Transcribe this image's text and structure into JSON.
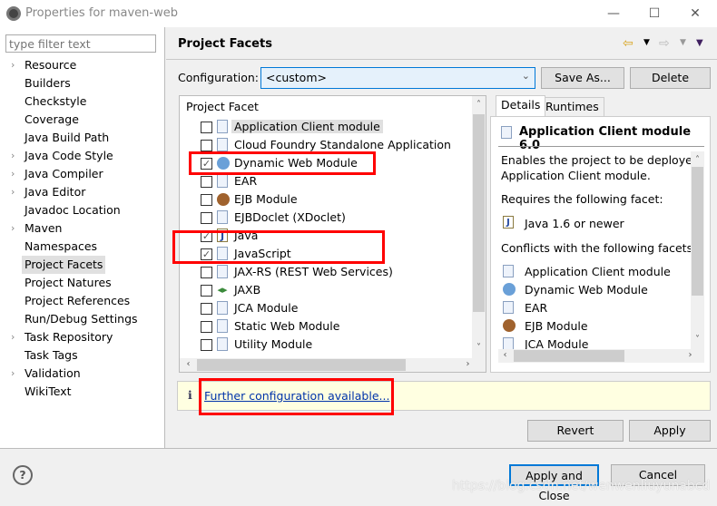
{
  "window": {
    "title": "Properties for maven-web",
    "minimize": "—",
    "maximize": "☐",
    "close": "✕"
  },
  "sidebar": {
    "filter_placeholder": "type filter text",
    "items": [
      {
        "label": "Resource",
        "expandable": true
      },
      {
        "label": "Builders",
        "expandable": false
      },
      {
        "label": "Checkstyle",
        "expandable": false
      },
      {
        "label": "Coverage",
        "expandable": false
      },
      {
        "label": "Java Build Path",
        "expandable": false
      },
      {
        "label": "Java Code Style",
        "expandable": true
      },
      {
        "label": "Java Compiler",
        "expandable": true
      },
      {
        "label": "Java Editor",
        "expandable": true
      },
      {
        "label": "Javadoc Location",
        "expandable": false
      },
      {
        "label": "Maven",
        "expandable": true
      },
      {
        "label": "Namespaces",
        "expandable": false
      },
      {
        "label": "Project Facets",
        "expandable": false,
        "selected": true
      },
      {
        "label": "Project Natures",
        "expandable": false
      },
      {
        "label": "Project References",
        "expandable": false
      },
      {
        "label": "Run/Debug Settings",
        "expandable": false
      },
      {
        "label": "Task Repository",
        "expandable": true
      },
      {
        "label": "Task Tags",
        "expandable": false
      },
      {
        "label": "Validation",
        "expandable": true
      },
      {
        "label": "WikiText",
        "expandable": false
      }
    ]
  },
  "header": {
    "title": "Project Facets",
    "back": "⇦",
    "forward": "⇨",
    "menu": "▼"
  },
  "configuration": {
    "label": "Configuration:",
    "value": "<custom>",
    "save_as": "Save As...",
    "delete": "Delete"
  },
  "facets": {
    "header": "Project Facet",
    "items": [
      {
        "label": "Application Client module",
        "checked": false,
        "icon": "doc"
      },
      {
        "label": "Cloud Foundry Standalone Application",
        "checked": false,
        "icon": "doc"
      },
      {
        "label": "Dynamic Web Module",
        "checked": true,
        "icon": "globe"
      },
      {
        "label": "EAR",
        "checked": false,
        "icon": "doc"
      },
      {
        "label": "EJB Module",
        "checked": false,
        "icon": "bean"
      },
      {
        "label": "EJBDoclet (XDoclet)",
        "checked": false,
        "icon": "doc"
      },
      {
        "label": "Java",
        "checked": true,
        "icon": "java"
      },
      {
        "label": "JavaScript",
        "checked": true,
        "icon": "doc"
      },
      {
        "label": "JAX-RS (REST Web Services)",
        "checked": false,
        "icon": "doc"
      },
      {
        "label": "JAXB",
        "checked": false,
        "icon": "jaxb"
      },
      {
        "label": "JCA Module",
        "checked": false,
        "icon": "doc"
      },
      {
        "label": "Static Web Module",
        "checked": false,
        "icon": "doc"
      },
      {
        "label": "Utility Module",
        "checked": false,
        "icon": "doc"
      }
    ]
  },
  "details": {
    "tabs": [
      "Details",
      "Runtimes"
    ],
    "title": "Application Client module 6.0",
    "description_1": "Enables the project to be deployed",
    "description_2": "Application Client module.",
    "requires_label": "Requires the following facet:",
    "requires": [
      "Java 1.6 or newer"
    ],
    "conflicts_label": "Conflicts with the following facets:",
    "conflicts": [
      {
        "label": "Application Client module",
        "icon": "doc"
      },
      {
        "label": "Dynamic Web Module",
        "icon": "globe"
      },
      {
        "label": "EAR",
        "icon": "doc"
      },
      {
        "label": "EJB Module",
        "icon": "bean"
      },
      {
        "label": "JCA Module",
        "icon": "doc"
      }
    ]
  },
  "info": {
    "icon": "i",
    "link": "Further configuration available..."
  },
  "buttons": {
    "revert": "Revert",
    "apply": "Apply",
    "apply_close": "Apply and Close",
    "cancel": "Cancel",
    "help": "?"
  },
  "watermark": "https://blog.csdn.net/wenwenliuyunabcd"
}
